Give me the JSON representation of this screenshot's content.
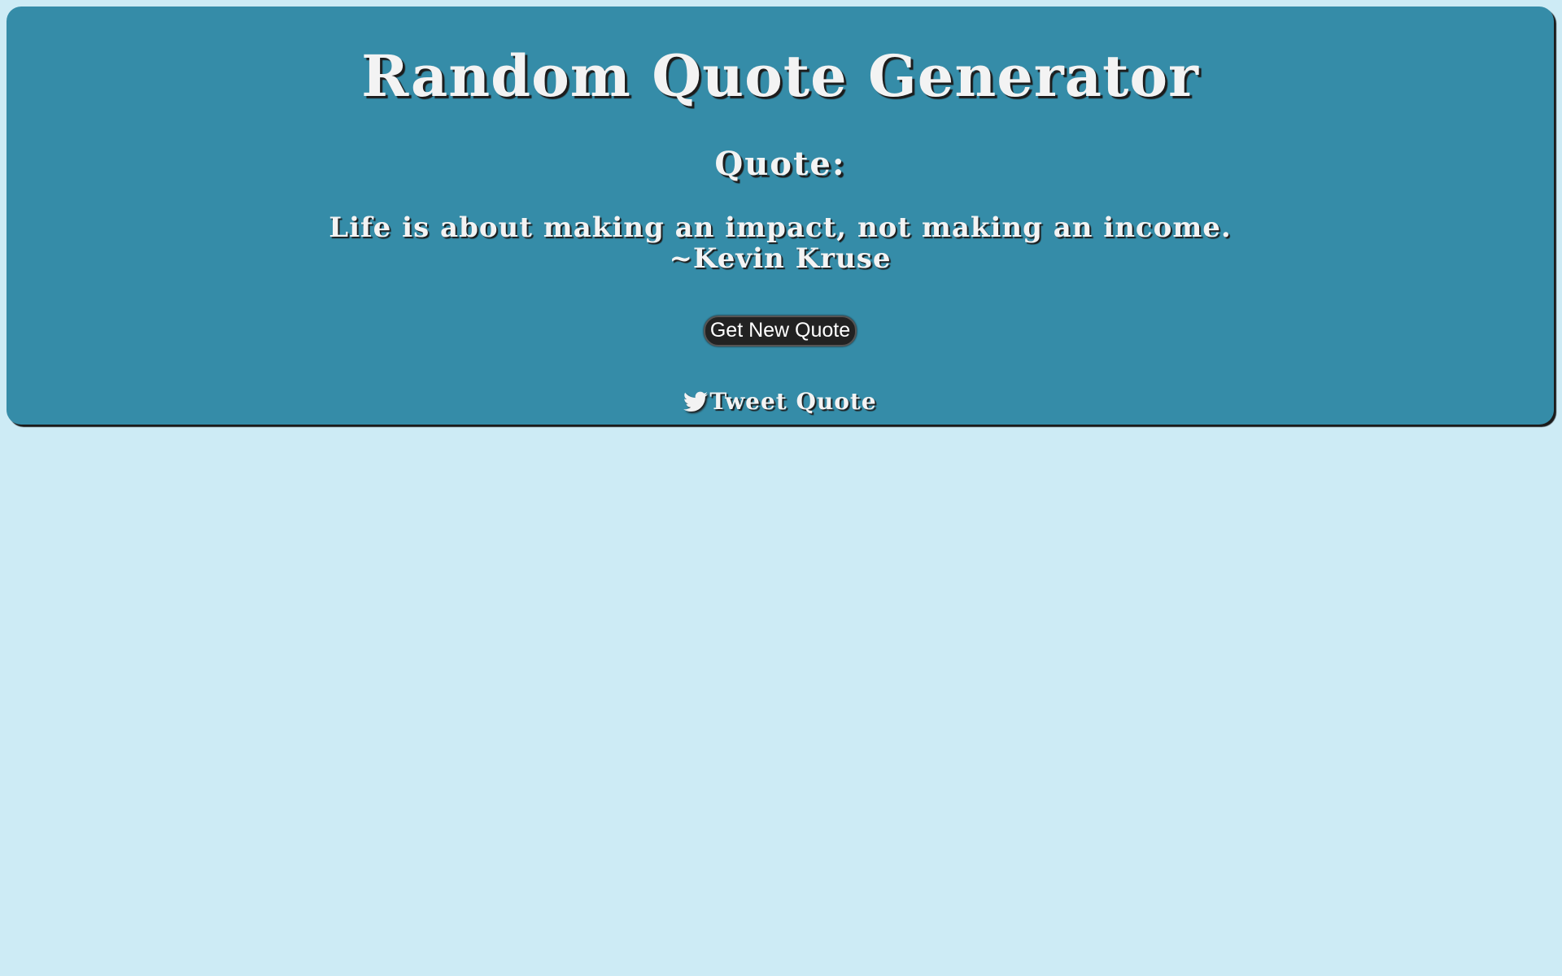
{
  "page": {
    "background_color": "#cdebf5",
    "panel_color": "#358ca8"
  },
  "header": {
    "title": "Random Quote Generator"
  },
  "quote": {
    "heading": "Quote:",
    "text": "Life is about making an impact, not making an income.",
    "author": "~Kevin Kruse"
  },
  "actions": {
    "new_quote_label": "Get New Quote",
    "tweet_label": "Tweet Quote",
    "tweet_icon": "twitter-bird-icon"
  }
}
